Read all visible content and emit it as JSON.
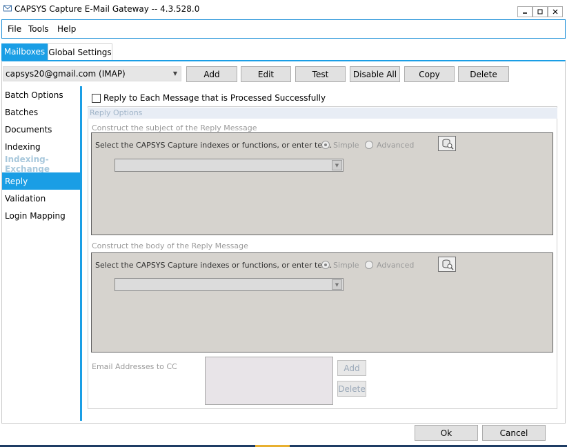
{
  "window": {
    "title": "CAPSYS Capture E-Mail Gateway -- 4.3.528.0",
    "icon": "envelope-icon"
  },
  "menu": [
    "File",
    "Tools",
    "Help"
  ],
  "tabs": [
    {
      "label": "Mailboxes",
      "active": true
    },
    {
      "label": "Global Settings",
      "active": false
    }
  ],
  "toolbar": {
    "mailbox": "capsys20@gmail.com (IMAP)",
    "buttons": [
      "Add",
      "Edit",
      "Test",
      "Disable All",
      "Copy",
      "Delete"
    ]
  },
  "sidebar": {
    "items": [
      {
        "label": "Batch Options",
        "state": "normal"
      },
      {
        "label": "Batches",
        "state": "normal"
      },
      {
        "label": "Documents",
        "state": "normal"
      },
      {
        "label": "Indexing",
        "state": "normal"
      },
      {
        "label": "Indexing-Exchange",
        "state": "disabled"
      },
      {
        "label": "Reply",
        "state": "active"
      },
      {
        "label": "Validation",
        "state": "normal"
      },
      {
        "label": "Login Mapping",
        "state": "normal"
      }
    ]
  },
  "reply": {
    "checkbox_label": "Reply to Each Message that is Processed Successfully",
    "checked": false,
    "options_header": "Reply Options",
    "subject": {
      "label": "Construct the subject of the Reply Message",
      "instruction": "Select the CAPSYS Capture indexes or functions, or enter text.",
      "simple": "Simple",
      "advanced": "Advanced",
      "mode": "simple"
    },
    "body": {
      "label": "Construct the body of the Reply Message",
      "instruction": "Select the CAPSYS Capture indexes or functions, or enter text.",
      "simple": "Simple",
      "advanced": "Advanced",
      "mode": "simple"
    },
    "cc": {
      "label": "Email Addresses to CC",
      "add": "Add",
      "delete": "Delete"
    }
  },
  "footer": {
    "ok": "Ok",
    "cancel": "Cancel"
  }
}
